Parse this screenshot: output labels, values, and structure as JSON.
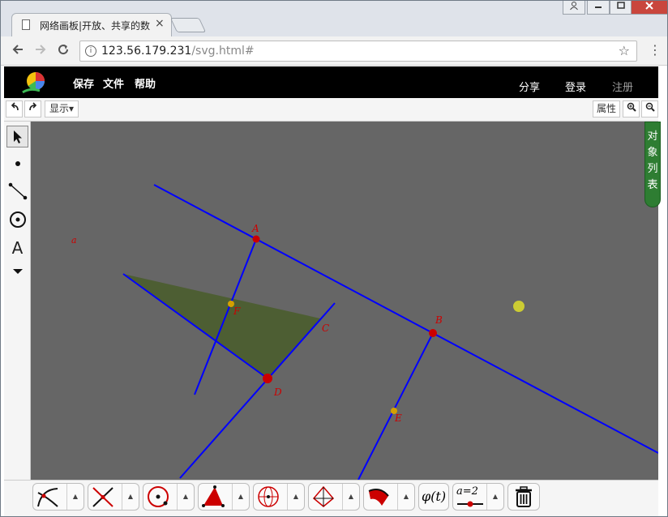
{
  "browser": {
    "tab_title": "网络画板|开放、共享的数",
    "close_tab": "×",
    "url_host": "123.56.179.231",
    "url_path": "/svg.html#",
    "window_buttons": [
      "user-icon",
      "minimize-icon",
      "maximize-icon",
      "close-icon"
    ],
    "nav_icons": [
      "back-icon",
      "forward-icon",
      "reload-icon"
    ]
  },
  "appbar": {
    "menu": [
      "保存",
      "文件",
      "帮助"
    ],
    "right": [
      "分享",
      "登录",
      "注册"
    ],
    "login_color": "#ffffff",
    "register_color": "#9e9e9e"
  },
  "apptools": {
    "show_label": "显示▾",
    "props_label": "属性",
    "icons": [
      "undo-icon",
      "redo-icon",
      "zoom-in-icon",
      "zoom-out-icon"
    ]
  },
  "palette": {
    "icons": [
      "select-arrow-icon",
      "point-icon",
      "segment-icon",
      "circle-icon",
      "text-icon",
      "more-down-icon"
    ],
    "text_tool_label": "A"
  },
  "canvas": {
    "background": "#666666",
    "object_list_label": "对象列表",
    "labels": {
      "A": "A",
      "B": "B",
      "C": "C",
      "D": "D",
      "E": "E",
      "F": "F",
      "a": "a"
    },
    "line_color": "#0000ff",
    "point_color": "#cc0000",
    "midpoint_color": "#d4a000",
    "triangle_fill": "#4d5e33"
  },
  "bottombar": {
    "tools": [
      "curve-tool-icon",
      "intersect-tool-icon",
      "circle-tool-icon",
      "polygon-tool-icon",
      "transform-tool-icon",
      "3d-tool-icon",
      "arc-tool-icon",
      "function-tool-icon",
      "parameter-slider-icon",
      "trash-icon"
    ],
    "function_label": "φ(t)",
    "parameter_label": "a=2"
  }
}
